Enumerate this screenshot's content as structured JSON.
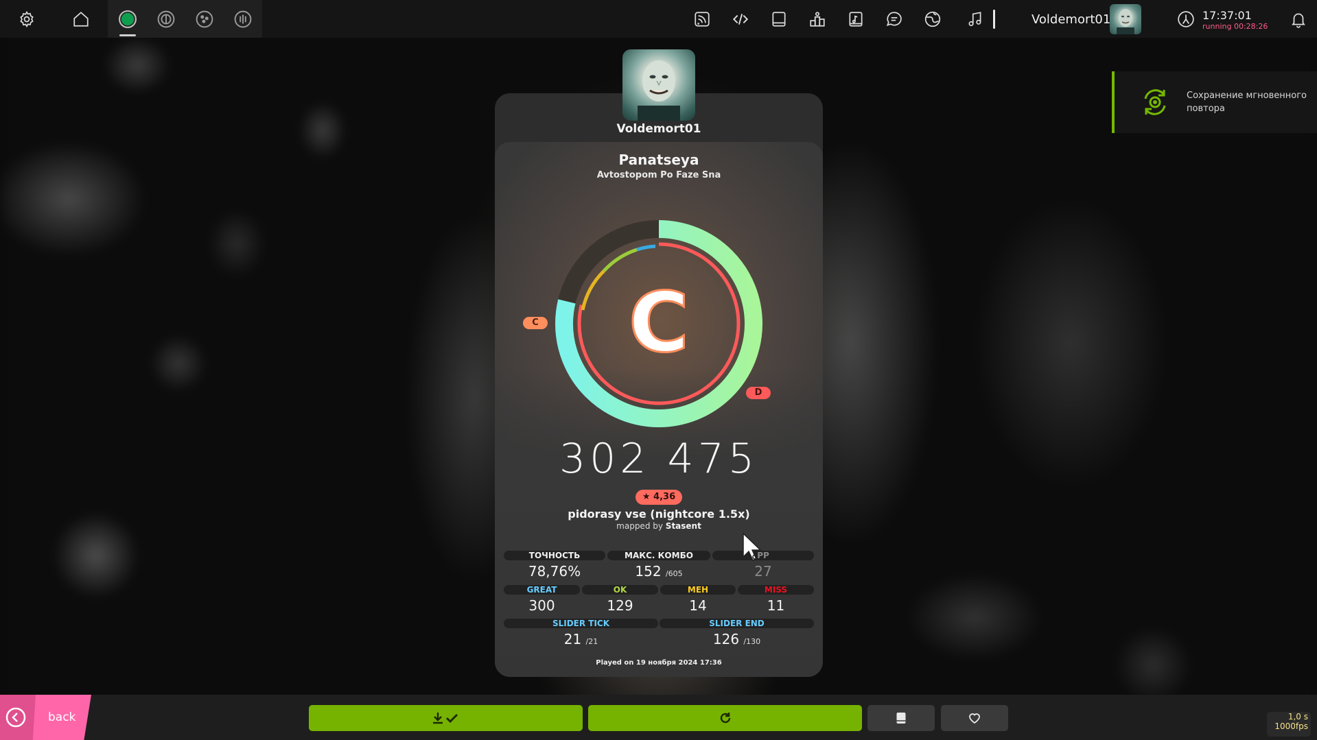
{
  "topbar": {
    "icons_left": [
      "gear-icon",
      "home-icon"
    ],
    "rulesets": [
      "osu-ruleset-icon",
      "taiko-ruleset-icon",
      "catch-ruleset-icon",
      "mania-ruleset-icon"
    ],
    "icons_right": [
      "rss-icon",
      "code-icon",
      "book-icon",
      "ranking-icon",
      "beatmap-listing-icon",
      "chat-icon",
      "globe-icon",
      "music-icon"
    ],
    "username": "Voldemort01",
    "clock_time": "17:37:01",
    "clock_running": "running 00:28:26"
  },
  "notification": {
    "text": "Сохранение мгновенного повтора",
    "accent": "#76b900"
  },
  "result": {
    "player": "Voldemort01",
    "title": "Panatseya",
    "artist": "Avtostopom Po Faze Sna",
    "rank": "C",
    "rank_prev_marker": "C",
    "rank_next_marker": "D",
    "accuracy_fraction": 0.7876,
    "score": "302 475",
    "star_rating": "★ 4,36",
    "difficulty": "pidorasy vse (nightcore 1.5x)",
    "mapped_by_prefix": "mapped by",
    "mapper": "Stasent",
    "stats": {
      "accuracy_label": "ТОЧНОСТЬ",
      "accuracy_value": "78,76%",
      "combo_label": "МАКС. КОМБО",
      "combo_value": "152",
      "combo_max": "/605",
      "pp_label": "PP",
      "pp_value": "27",
      "great_label": "GREAT",
      "great_value": "300",
      "ok_label": "OK",
      "ok_value": "129",
      "meh_label": "MEH",
      "meh_value": "14",
      "miss_label": "MISS",
      "miss_value": "11",
      "slider_tick_label": "SLIDER TICK",
      "slider_tick_value": "21",
      "slider_tick_max": "/21",
      "slider_end_label": "SLIDER END",
      "slider_end_value": "126",
      "slider_end_max": "/130"
    },
    "played_on": "Played on 19 ноября 2024 17:36",
    "colors": {
      "great": "#66ccff",
      "ok": "#b3d944",
      "meh": "#ffcc22",
      "miss": "#ed1121",
      "rank_c": "#ff8e5d"
    }
  },
  "bottombar": {
    "back_label": "back",
    "buttons": [
      "download-done-icon",
      "retry-icon",
      "book-icon",
      "heart-icon"
    ],
    "fps_value": "1,0 s",
    "fps_text": "1000fps"
  }
}
